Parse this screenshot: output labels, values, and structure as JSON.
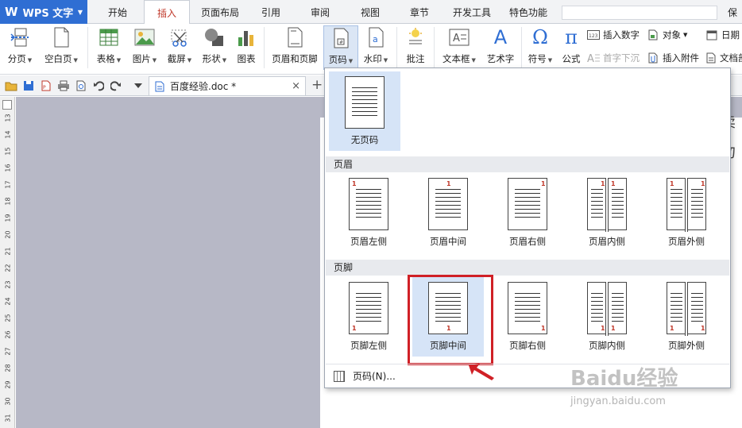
{
  "app": {
    "title": "WPS 文字"
  },
  "tabs": [
    "开始",
    "插入",
    "页面布局",
    "引用",
    "审阅",
    "视图",
    "章节",
    "开发工具",
    "特色功能"
  ],
  "active_tab": "插入",
  "top_right_label": "保存",
  "ribbon": {
    "buttons": [
      {
        "id": "page-break",
        "label": "分页",
        "dd": true
      },
      {
        "id": "blank-page",
        "label": "空白页",
        "dd": true
      },
      {
        "id": "table",
        "label": "表格",
        "dd": true
      },
      {
        "id": "picture",
        "label": "图片",
        "dd": true
      },
      {
        "id": "screenshot",
        "label": "截屏",
        "dd": true
      },
      {
        "id": "shapes",
        "label": "形状",
        "dd": true
      },
      {
        "id": "chart",
        "label": "图表",
        "dd": false
      },
      {
        "id": "header-footer",
        "label": "页眉和页脚",
        "dd": false
      },
      {
        "id": "page-number",
        "label": "页码",
        "dd": true
      },
      {
        "id": "watermark",
        "label": "水印",
        "dd": true
      },
      {
        "id": "comment",
        "label": "批注",
        "dd": false
      },
      {
        "id": "textbox",
        "label": "文本框",
        "dd": true
      },
      {
        "id": "wordart",
        "label": "艺术字",
        "dd": false
      },
      {
        "id": "symbol",
        "label": "符号",
        "dd": true
      },
      {
        "id": "formula",
        "label": "公式",
        "dd": false
      }
    ],
    "small": [
      {
        "id": "insert-number",
        "label": "插入数字"
      },
      {
        "id": "object",
        "label": "对象",
        "dd": true
      },
      {
        "id": "date",
        "label": "日期"
      },
      {
        "id": "drop-cap",
        "label": "首字下沉",
        "disabled": true
      },
      {
        "id": "insert-attachment",
        "label": "插入附件"
      },
      {
        "id": "doc-part",
        "label": "文档部"
      }
    ]
  },
  "document_tab": {
    "name": "百度经验.doc *",
    "close": "×",
    "new": "+"
  },
  "ruler_numbers": [
    "13",
    "14",
    "15",
    "16",
    "17",
    "18",
    "19",
    "20",
    "21",
    "22",
    "23",
    "24",
    "25",
    "26",
    "27",
    "28",
    "29",
    "30",
    "31"
  ],
  "dropdown": {
    "none_label": "无页码",
    "section_header": "页眉",
    "section_footer": "页脚",
    "header_items": [
      "页眉左侧",
      "页眉中间",
      "页眉右侧",
      "页眉内侧",
      "页眉外侧"
    ],
    "footer_items": [
      "页脚左侧",
      "页脚中间",
      "页脚右侧",
      "页脚内侧",
      "页脚外侧"
    ],
    "footer_selected": "页脚中间",
    "footer_option": "页码(N)...",
    "page_number_sample": "1"
  },
  "watermark": {
    "brand": "Baidu经验",
    "url": "jingyan.baidu.com"
  },
  "colors": {
    "accent_blue": "#2f6ed3",
    "active_tab_text": "#c0392b",
    "highlight_red": "#d02026",
    "canvas": "#b7b8c6"
  }
}
